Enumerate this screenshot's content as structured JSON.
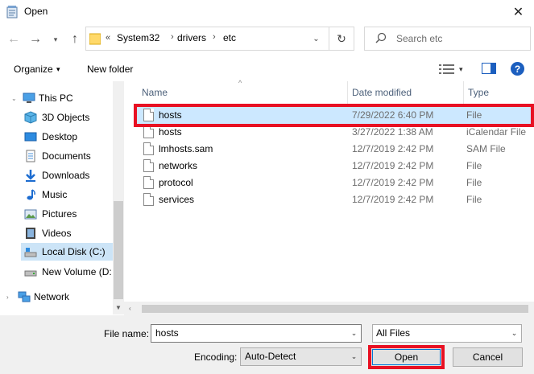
{
  "window": {
    "title": "Open",
    "close_glyph": "✕"
  },
  "nav": {
    "back_glyph": "←",
    "forward_glyph": "→",
    "recent_glyph": "▾",
    "up_glyph": "↑",
    "address": {
      "overflow": "«",
      "crumbs": [
        "System32",
        "drivers",
        "etc"
      ],
      "separator": "›",
      "dropdown_glyph": "⌄",
      "refresh_glyph": "↻"
    },
    "search": {
      "placeholder": "Search etc"
    }
  },
  "toolbar": {
    "organize_label": "Organize",
    "dropdown_glyph": "▾",
    "new_folder_label": "New folder",
    "help_glyph": "?"
  },
  "sidebar": {
    "items": [
      {
        "label": "This PC",
        "icon": "pc-icon",
        "expander": "⌄"
      },
      {
        "label": "3D Objects",
        "icon": "3d-objects-icon"
      },
      {
        "label": "Desktop",
        "icon": "desktop-icon"
      },
      {
        "label": "Documents",
        "icon": "documents-icon"
      },
      {
        "label": "Downloads",
        "icon": "downloads-icon"
      },
      {
        "label": "Music",
        "icon": "music-icon"
      },
      {
        "label": "Pictures",
        "icon": "pictures-icon"
      },
      {
        "label": "Videos",
        "icon": "videos-icon"
      },
      {
        "label": "Local Disk (C:)",
        "icon": "drive-icon",
        "selected": true
      },
      {
        "label": "New Volume (D:",
        "icon": "drive-icon"
      },
      {
        "label": "Network",
        "icon": "network-icon",
        "expander": "›"
      }
    ]
  },
  "filelist": {
    "columns": {
      "name": "Name",
      "date": "Date modified",
      "type": "Type",
      "sort_glyph": "^"
    },
    "rows": [
      {
        "name": "hosts",
        "date": "7/29/2022 6:40 PM",
        "type": "File",
        "selected": true
      },
      {
        "name": "hosts",
        "date": "3/27/2022 1:38 AM",
        "type": "iCalendar File"
      },
      {
        "name": "lmhosts.sam",
        "date": "12/7/2019 2:42 PM",
        "type": "SAM File"
      },
      {
        "name": "networks",
        "date": "12/7/2019 2:42 PM",
        "type": "File"
      },
      {
        "name": "protocol",
        "date": "12/7/2019 2:42 PM",
        "type": "File"
      },
      {
        "name": "services",
        "date": "12/7/2019 2:42 PM",
        "type": "File"
      }
    ],
    "scroll_glyph": "‹"
  },
  "footer": {
    "filename_label": "File name:",
    "filename_value": "hosts",
    "filter_value": "All Files",
    "encoding_label": "Encoding:",
    "encoding_value": "Auto-Detect",
    "select_glyph": "⌄",
    "open_label": "Open",
    "cancel_label": "Cancel"
  },
  "colors": {
    "highlight": "#e81123",
    "selection": "#cce8ff",
    "accent": "#0078d7"
  }
}
